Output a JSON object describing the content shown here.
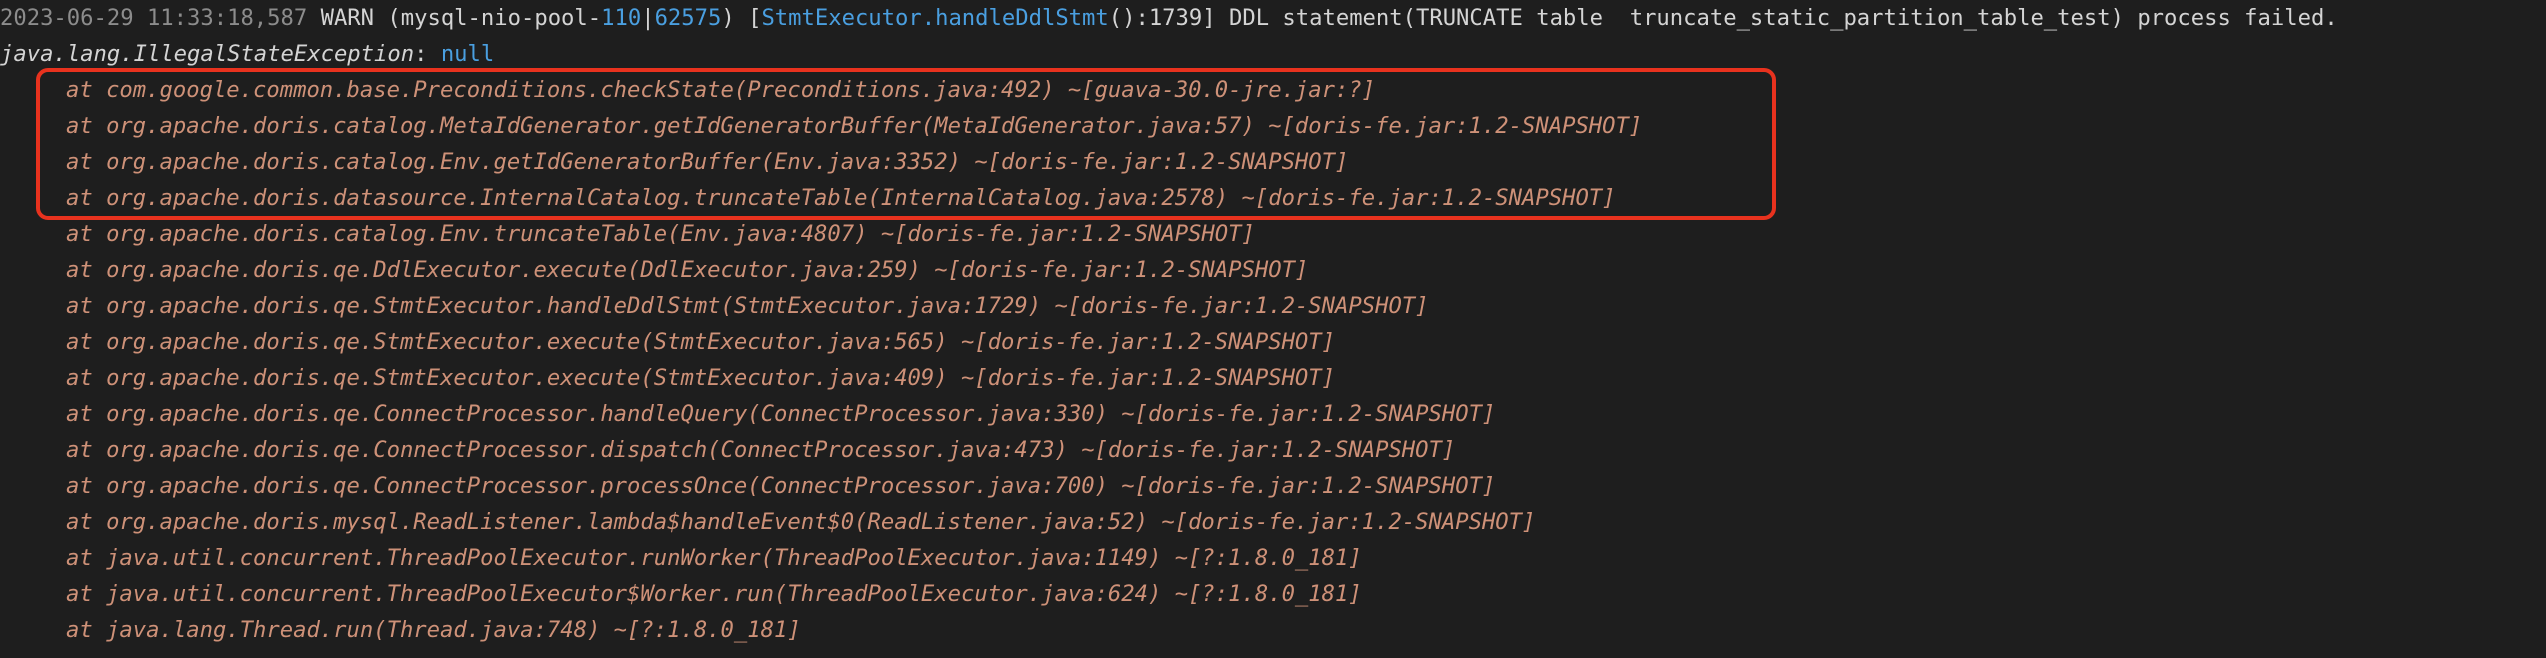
{
  "header": {
    "timestamp": "2023-06-29 11:33:18,587",
    "level": "WARN",
    "open_paren": " (",
    "thread_name": "mysql-nio-pool-",
    "thread_num": "110",
    "pipe": "|",
    "thread_id": "62575",
    "close_paren": ") [",
    "logger": "StmtExecutor.handleDdlStmt",
    "line_suffix": "():1739] DDL statement(TRUNCATE table  truncate_static_partition_table_test) process failed."
  },
  "exception": {
    "class": "java.lang.IllegalStateException",
    "separator": ": ",
    "message": "null"
  },
  "stack": [
    "at com.google.common.base.Preconditions.checkState(Preconditions.java:492) ~[guava-30.0-jre.jar:?]",
    "at org.apache.doris.catalog.MetaIdGenerator.getIdGeneratorBuffer(MetaIdGenerator.java:57) ~[doris-fe.jar:1.2-SNAPSHOT]",
    "at org.apache.doris.catalog.Env.getIdGeneratorBuffer(Env.java:3352) ~[doris-fe.jar:1.2-SNAPSHOT]",
    "at org.apache.doris.datasource.InternalCatalog.truncateTable(InternalCatalog.java:2578) ~[doris-fe.jar:1.2-SNAPSHOT]",
    "at org.apache.doris.catalog.Env.truncateTable(Env.java:4807) ~[doris-fe.jar:1.2-SNAPSHOT]",
    "at org.apache.doris.qe.DdlExecutor.execute(DdlExecutor.java:259) ~[doris-fe.jar:1.2-SNAPSHOT]",
    "at org.apache.doris.qe.StmtExecutor.handleDdlStmt(StmtExecutor.java:1729) ~[doris-fe.jar:1.2-SNAPSHOT]",
    "at org.apache.doris.qe.StmtExecutor.execute(StmtExecutor.java:565) ~[doris-fe.jar:1.2-SNAPSHOT]",
    "at org.apache.doris.qe.StmtExecutor.execute(StmtExecutor.java:409) ~[doris-fe.jar:1.2-SNAPSHOT]",
    "at org.apache.doris.qe.ConnectProcessor.handleQuery(ConnectProcessor.java:330) ~[doris-fe.jar:1.2-SNAPSHOT]",
    "at org.apache.doris.qe.ConnectProcessor.dispatch(ConnectProcessor.java:473) ~[doris-fe.jar:1.2-SNAPSHOT]",
    "at org.apache.doris.qe.ConnectProcessor.processOnce(ConnectProcessor.java:700) ~[doris-fe.jar:1.2-SNAPSHOT]",
    "at org.apache.doris.mysql.ReadListener.lambda$handleEvent$0(ReadListener.java:52) ~[doris-fe.jar:1.2-SNAPSHOT]",
    "at java.util.concurrent.ThreadPoolExecutor.runWorker(ThreadPoolExecutor.java:1149) ~[?:1.8.0_181]",
    "at java.util.concurrent.ThreadPoolExecutor$Worker.run(ThreadPoolExecutor.java:624) ~[?:1.8.0_181]",
    "at java.lang.Thread.run(Thread.java:748) ~[?:1.8.0_181]"
  ],
  "colors": {
    "background": "#1e1e1e",
    "stack_text": "#ce9178",
    "accent_blue": "#4a9fe0",
    "highlight_border": "#e8321e"
  }
}
